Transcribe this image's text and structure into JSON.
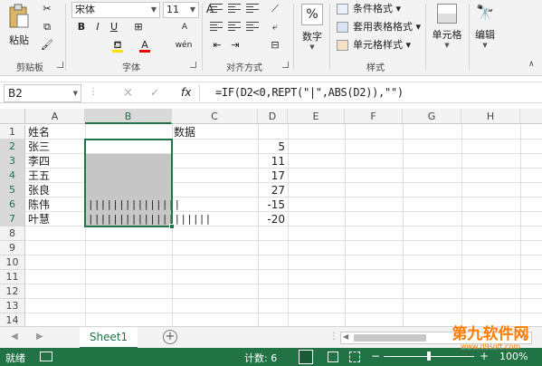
{
  "ribbon": {
    "clipboard": {
      "paste": "粘贴",
      "group": "剪贴板"
    },
    "font": {
      "name": "宋体",
      "size": "11",
      "bold": "B",
      "italic": "I",
      "underline": "U",
      "grow": "A",
      "shrink": "A",
      "wen": "wén",
      "group": "字体",
      "font_color": "A"
    },
    "align": {
      "group": "对齐方式"
    },
    "number": {
      "label": "数字",
      "icon": "%"
    },
    "styles": {
      "cond": "条件格式",
      "table": "套用表格格式",
      "cell": "单元格样式",
      "group": "样式"
    },
    "cells": {
      "label": "单元格"
    },
    "edit": {
      "label": "编辑"
    }
  },
  "formula_bar": {
    "name_box": "B2",
    "cancel": "×",
    "enter": "✓",
    "fx": "fx",
    "formula": "=IF(D2<0,REPT(\"|\",ABS(D2)),\"\")"
  },
  "grid": {
    "columns": [
      "A",
      "B",
      "C",
      "D",
      "E",
      "F",
      "G",
      "H"
    ],
    "rows": [
      "1",
      "2",
      "3",
      "4",
      "5",
      "6",
      "7",
      "8",
      "9",
      "10",
      "11",
      "12",
      "13",
      "14"
    ],
    "cells": {
      "a1": "姓名",
      "c1": "数据",
      "a2": "张三",
      "a3": "李四",
      "a4": "王五",
      "a5": "张良",
      "a6": "陈伟",
      "a7": "叶慧",
      "d2": "5",
      "d3": "11",
      "d4": "17",
      "d5": "27",
      "d6": "-15",
      "d7": "-20",
      "b6": "|||||||||||||||",
      "b7": "||||||||||||||||||||"
    }
  },
  "tabs": {
    "sheet": "Sheet1",
    "add": "+"
  },
  "status": {
    "ready": "就绪",
    "count": "计数: 6",
    "zoom": "100%"
  },
  "colors": {
    "accent": "#217346",
    "selection_fill": "#c6c6c6"
  },
  "watermark": {
    "text": "第九软件网",
    "url": "www.d9soft.com"
  }
}
